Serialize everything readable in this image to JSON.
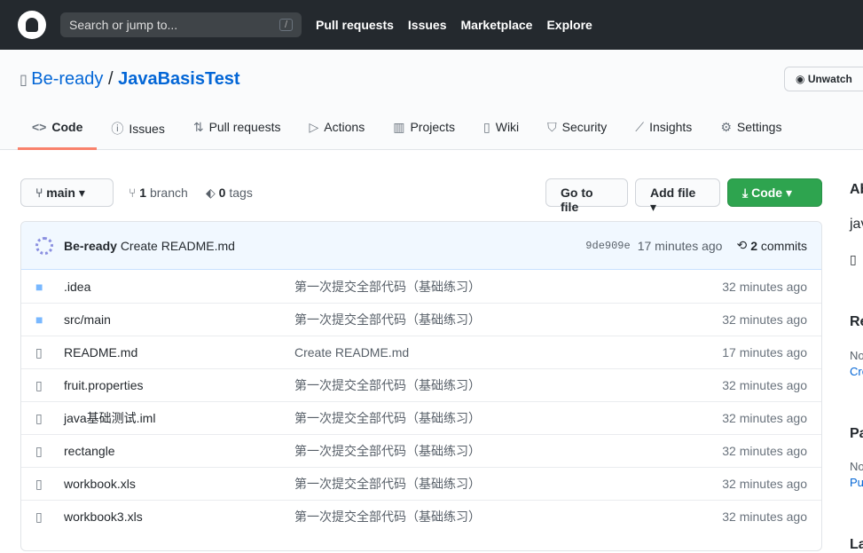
{
  "header": {
    "search_placeholder": "Search or jump to...",
    "slash": "/",
    "nav": [
      "Pull requests",
      "Issues",
      "Marketplace",
      "Explore"
    ]
  },
  "repo": {
    "owner": "Be-ready",
    "sep": "/",
    "name": "JavaBasisTest",
    "unwatch": "Unwatch"
  },
  "tabs": [
    {
      "icon": "code-icon",
      "glyph": "<>",
      "label": "Code"
    },
    {
      "icon": "issue-icon",
      "glyph": "ⓘ",
      "label": "Issues"
    },
    {
      "icon": "pull-request-icon",
      "glyph": "⇅",
      "label": "Pull requests"
    },
    {
      "icon": "play-icon",
      "glyph": "▷",
      "label": "Actions"
    },
    {
      "icon": "project-icon",
      "glyph": "▥",
      "label": "Projects"
    },
    {
      "icon": "book-icon",
      "glyph": "▯",
      "label": "Wiki"
    },
    {
      "icon": "shield-icon",
      "glyph": "⛉",
      "label": "Security"
    },
    {
      "icon": "graph-icon",
      "glyph": "⟋",
      "label": "Insights"
    },
    {
      "icon": "gear-icon",
      "glyph": "⚙",
      "label": "Settings"
    }
  ],
  "toolbar": {
    "branch": "main",
    "branches_count": "1",
    "branches_label": "branch",
    "tags_count": "0",
    "tags_label": "tags",
    "go_to_file": "Go to file",
    "add_file": "Add file",
    "code": "Code"
  },
  "commit": {
    "author": "Be-ready",
    "message": "Create README.md",
    "sha": "9de909e",
    "time": "17 minutes ago",
    "commits_count": "2",
    "commits_label": "commits"
  },
  "files": [
    {
      "type": "dir",
      "name": ".idea",
      "msg": "第一次提交全部代码（基础练习）",
      "age": "32 minutes ago"
    },
    {
      "type": "dir",
      "name": "src/main",
      "msg": "第一次提交全部代码（基础练习）",
      "age": "32 minutes ago"
    },
    {
      "type": "file",
      "name": "README.md",
      "msg": "Create README.md",
      "age": "17 minutes ago"
    },
    {
      "type": "file",
      "name": "fruit.properties",
      "msg": "第一次提交全部代码（基础练习）",
      "age": "32 minutes ago"
    },
    {
      "type": "file",
      "name": "java基础测试.iml",
      "msg": "第一次提交全部代码（基础练习）",
      "age": "32 minutes ago"
    },
    {
      "type": "file",
      "name": "rectangle",
      "msg": "第一次提交全部代码（基础练习）",
      "age": "32 minutes ago"
    },
    {
      "type": "file",
      "name": "workbook.xls",
      "msg": "第一次提交全部代码（基础练习）",
      "age": "32 minutes ago"
    },
    {
      "type": "file",
      "name": "workbook3.xls",
      "msg": "第一次提交全部代码（基础练习）",
      "age": "32 minutes ago"
    }
  ],
  "sidebar": {
    "about": "Ab",
    "desc": "jav",
    "releases": "Re",
    "releases_none": "No",
    "releases_link": "Cre",
    "packages": "Pa",
    "packages_none": "No",
    "packages_link": "Pu",
    "languages": "La"
  }
}
